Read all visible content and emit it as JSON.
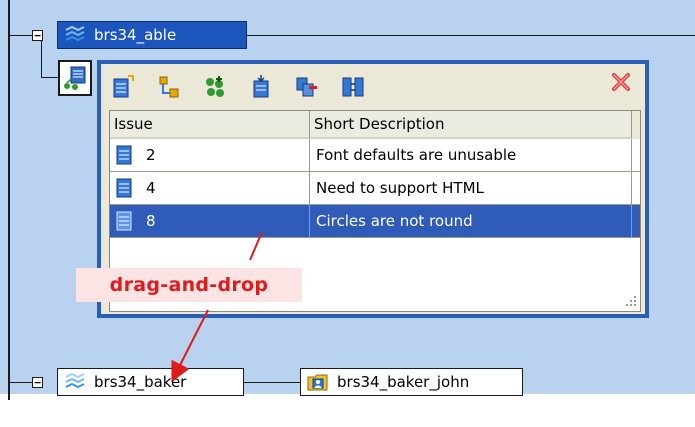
{
  "tree": {
    "node_able": {
      "label": "brs34_able",
      "expander": "−"
    },
    "node_baker": {
      "label": "brs34_baker",
      "expander": "−"
    },
    "node_baker_john": {
      "label": "brs34_baker_john"
    }
  },
  "popup": {
    "toolbar": [
      {
        "icon": "new-issue-icon"
      },
      {
        "icon": "hierarchy-icon"
      },
      {
        "icon": "add-items-icon"
      },
      {
        "icon": "import-icon"
      },
      {
        "icon": "remove-icon"
      },
      {
        "icon": "compare-icon"
      }
    ],
    "close_icon": "close-icon",
    "table": {
      "columns": [
        "Issue",
        "Short Description"
      ],
      "rows": [
        {
          "issue": "2",
          "description": "Font defaults are unusable",
          "selected": false
        },
        {
          "issue": "4",
          "description": "Need to support HTML",
          "selected": false
        },
        {
          "issue": "8",
          "description": "Circles are not round",
          "selected": true
        }
      ]
    }
  },
  "annotation": {
    "text": "drag-and-drop",
    "color": "#e01b1b"
  },
  "colors": {
    "background": "#b9d2ef",
    "selection": "#2e5cb8",
    "popup_border": "#2b5fb5"
  }
}
